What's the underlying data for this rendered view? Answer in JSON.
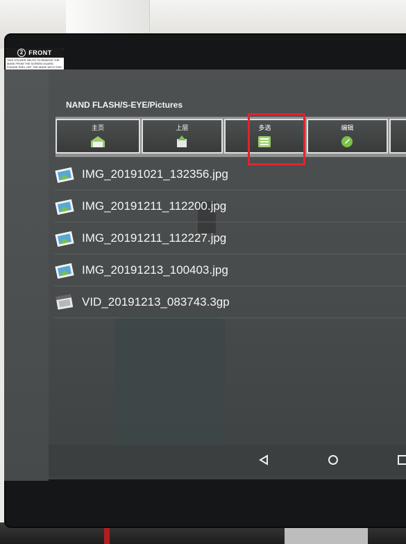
{
  "sticker": {
    "number": "2",
    "label": "FRONT",
    "note": "This sticker helps to remove the mask from the screen guard. Please peel off the mask with this sticker"
  },
  "path": "NAND FLASH/S-EYE/Pictures",
  "toolbar": [
    {
      "label": "主页",
      "icon": "home-icon"
    },
    {
      "label": "上层",
      "icon": "up-level-icon"
    },
    {
      "label": "多选",
      "icon": "multi-select-icon"
    },
    {
      "label": "编辑",
      "icon": "edit-icon"
    },
    {
      "label": "",
      "icon": "more-icon"
    }
  ],
  "files": [
    {
      "name": "IMG_20191021_132356.jpg",
      "type": "image"
    },
    {
      "name": "IMG_20191211_112200.jpg",
      "type": "image"
    },
    {
      "name": "IMG_20191211_112227.jpg",
      "type": "image"
    },
    {
      "name": "IMG_20191213_100403.jpg",
      "type": "image"
    },
    {
      "name": "VID_20191213_083743.3gp",
      "type": "video"
    }
  ],
  "navbar": [
    "back-icon",
    "home-circle-icon",
    "recents-icon"
  ],
  "colors": {
    "highlight": "#e2232e",
    "screen": "#4a4e4f",
    "toolbar": "#8f9291"
  }
}
